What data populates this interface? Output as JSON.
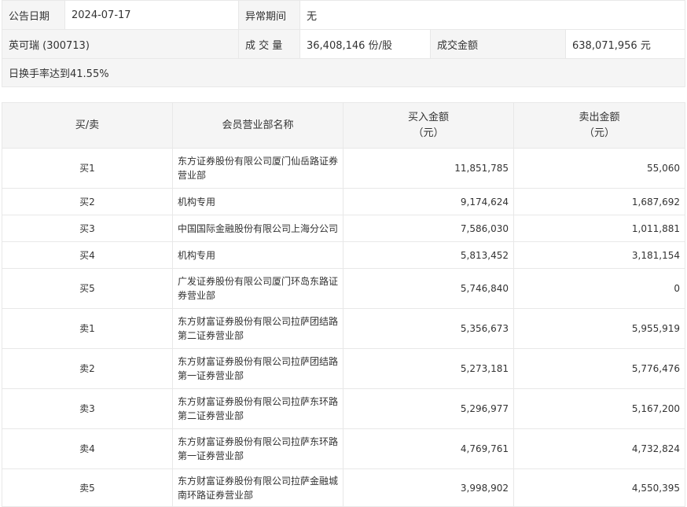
{
  "summary": {
    "date_label": "公告日期",
    "date_value": "2024-07-17",
    "abnormal_label": "异常期间",
    "abnormal_value": "无",
    "stock": "英可瑞 (300713)",
    "volume_label": "成 交 量",
    "volume_value": "36,408,146 份/股",
    "amount_label": "成交金额",
    "amount_value": "638,071,956 元",
    "reason": "日换手率达到41.55%"
  },
  "table": {
    "headers": {
      "side": "买/卖",
      "name": "会员营业部名称",
      "buy_line1": "买入金额",
      "buy_line2": "（元）",
      "sell_line1": "卖出金额",
      "sell_line2": "（元）"
    },
    "rows": [
      {
        "side": "买1",
        "name": "东方证券股份有限公司厦门仙岳路证券营业部",
        "buy": "11,851,785",
        "sell": "55,060"
      },
      {
        "side": "买2",
        "name": "机构专用",
        "buy": "9,174,624",
        "sell": "1,687,692"
      },
      {
        "side": "买3",
        "name": "中国国际金融股份有限公司上海分公司",
        "buy": "7,586,030",
        "sell": "1,011,881"
      },
      {
        "side": "买4",
        "name": "机构专用",
        "buy": "5,813,452",
        "sell": "3,181,154"
      },
      {
        "side": "买5",
        "name": "广发证券股份有限公司厦门环岛东路证券营业部",
        "buy": "5,746,840",
        "sell": "0"
      },
      {
        "side": "卖1",
        "name": "东方财富证券股份有限公司拉萨团结路第二证券营业部",
        "buy": "5,356,673",
        "sell": "5,955,919"
      },
      {
        "side": "卖2",
        "name": "东方财富证券股份有限公司拉萨团结路第一证券营业部",
        "buy": "5,273,181",
        "sell": "5,776,476"
      },
      {
        "side": "卖3",
        "name": "东方财富证券股份有限公司拉萨东环路第二证券营业部",
        "buy": "5,296,977",
        "sell": "5,167,200"
      },
      {
        "side": "卖4",
        "name": "东方财富证券股份有限公司拉萨东环路第一证券营业部",
        "buy": "4,769,761",
        "sell": "4,732,824"
      },
      {
        "side": "卖5",
        "name": "东方财富证券股份有限公司拉萨金融城南环路证券营业部",
        "buy": "3,998,902",
        "sell": "4,550,395"
      }
    ]
  }
}
